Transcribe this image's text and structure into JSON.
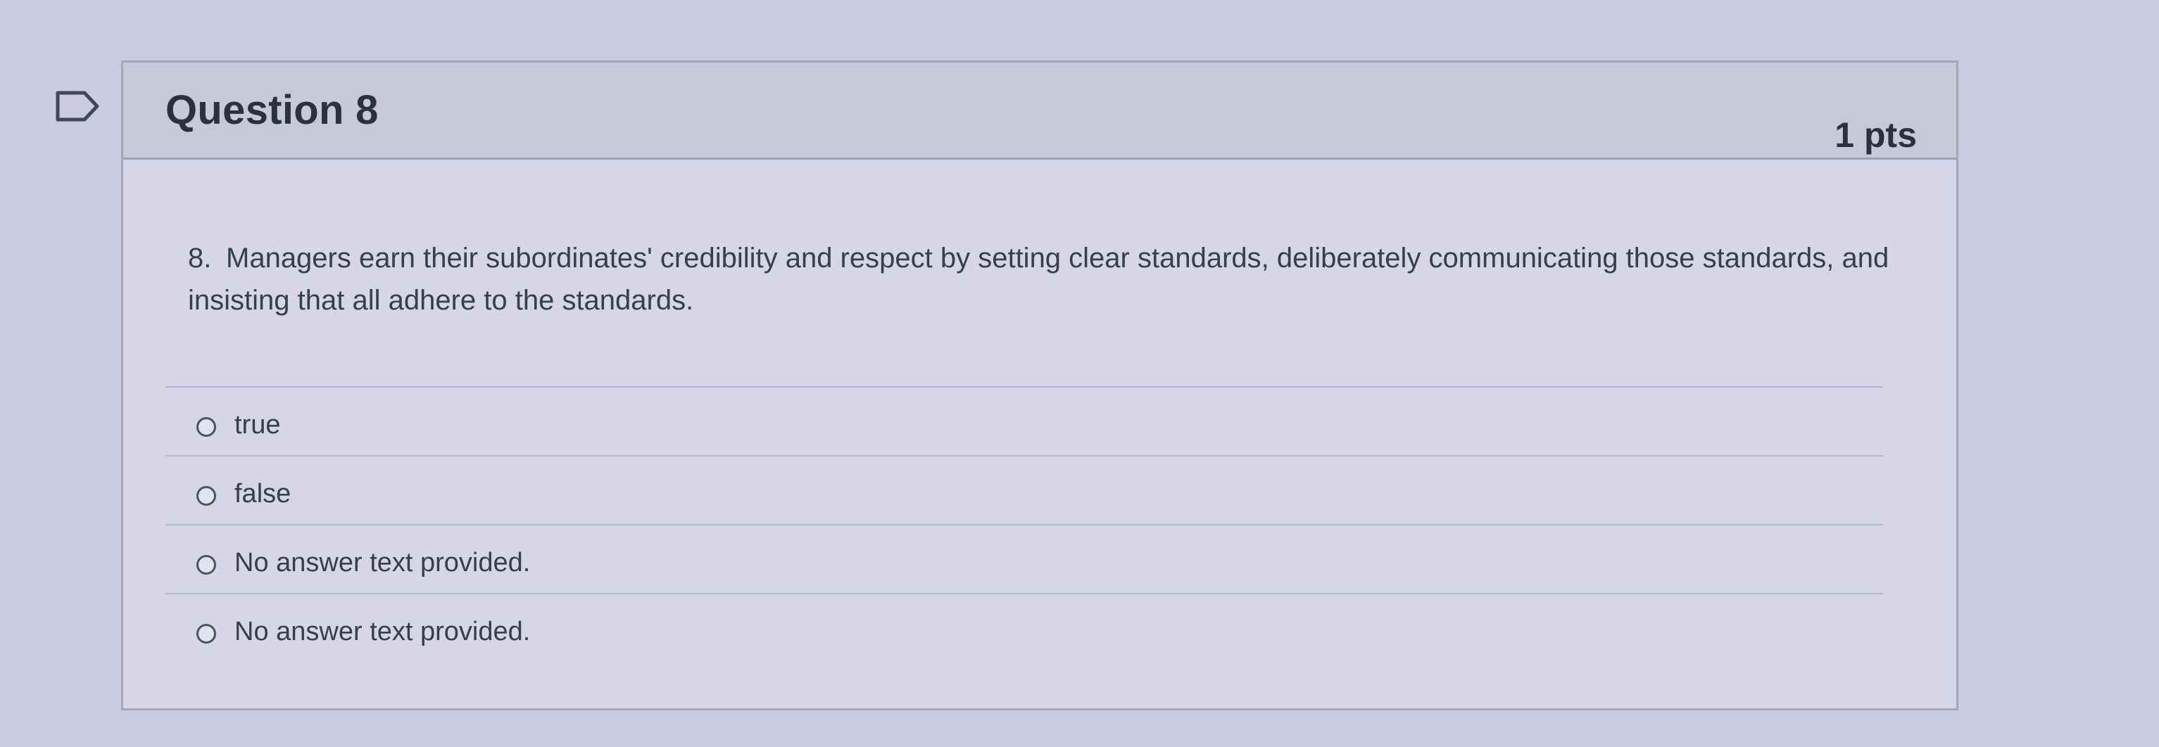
{
  "question": {
    "title": "Question 8",
    "points": "1 pts",
    "number": "8.",
    "text": "Managers earn their subordinates' credibility and respect by setting clear standards, deliberately communicating those standards, and insisting that all adhere to the standards."
  },
  "answers": [
    {
      "label": "true"
    },
    {
      "label": "false"
    },
    {
      "label": "No answer text provided."
    },
    {
      "label": "No answer text provided."
    }
  ],
  "icons": {
    "flag": "flag-outline-icon",
    "radio": "radio-unselected-icon"
  },
  "colors": {
    "background": "#cbcbe0",
    "header": "#c7c8d8",
    "text": "#2d3b45"
  }
}
